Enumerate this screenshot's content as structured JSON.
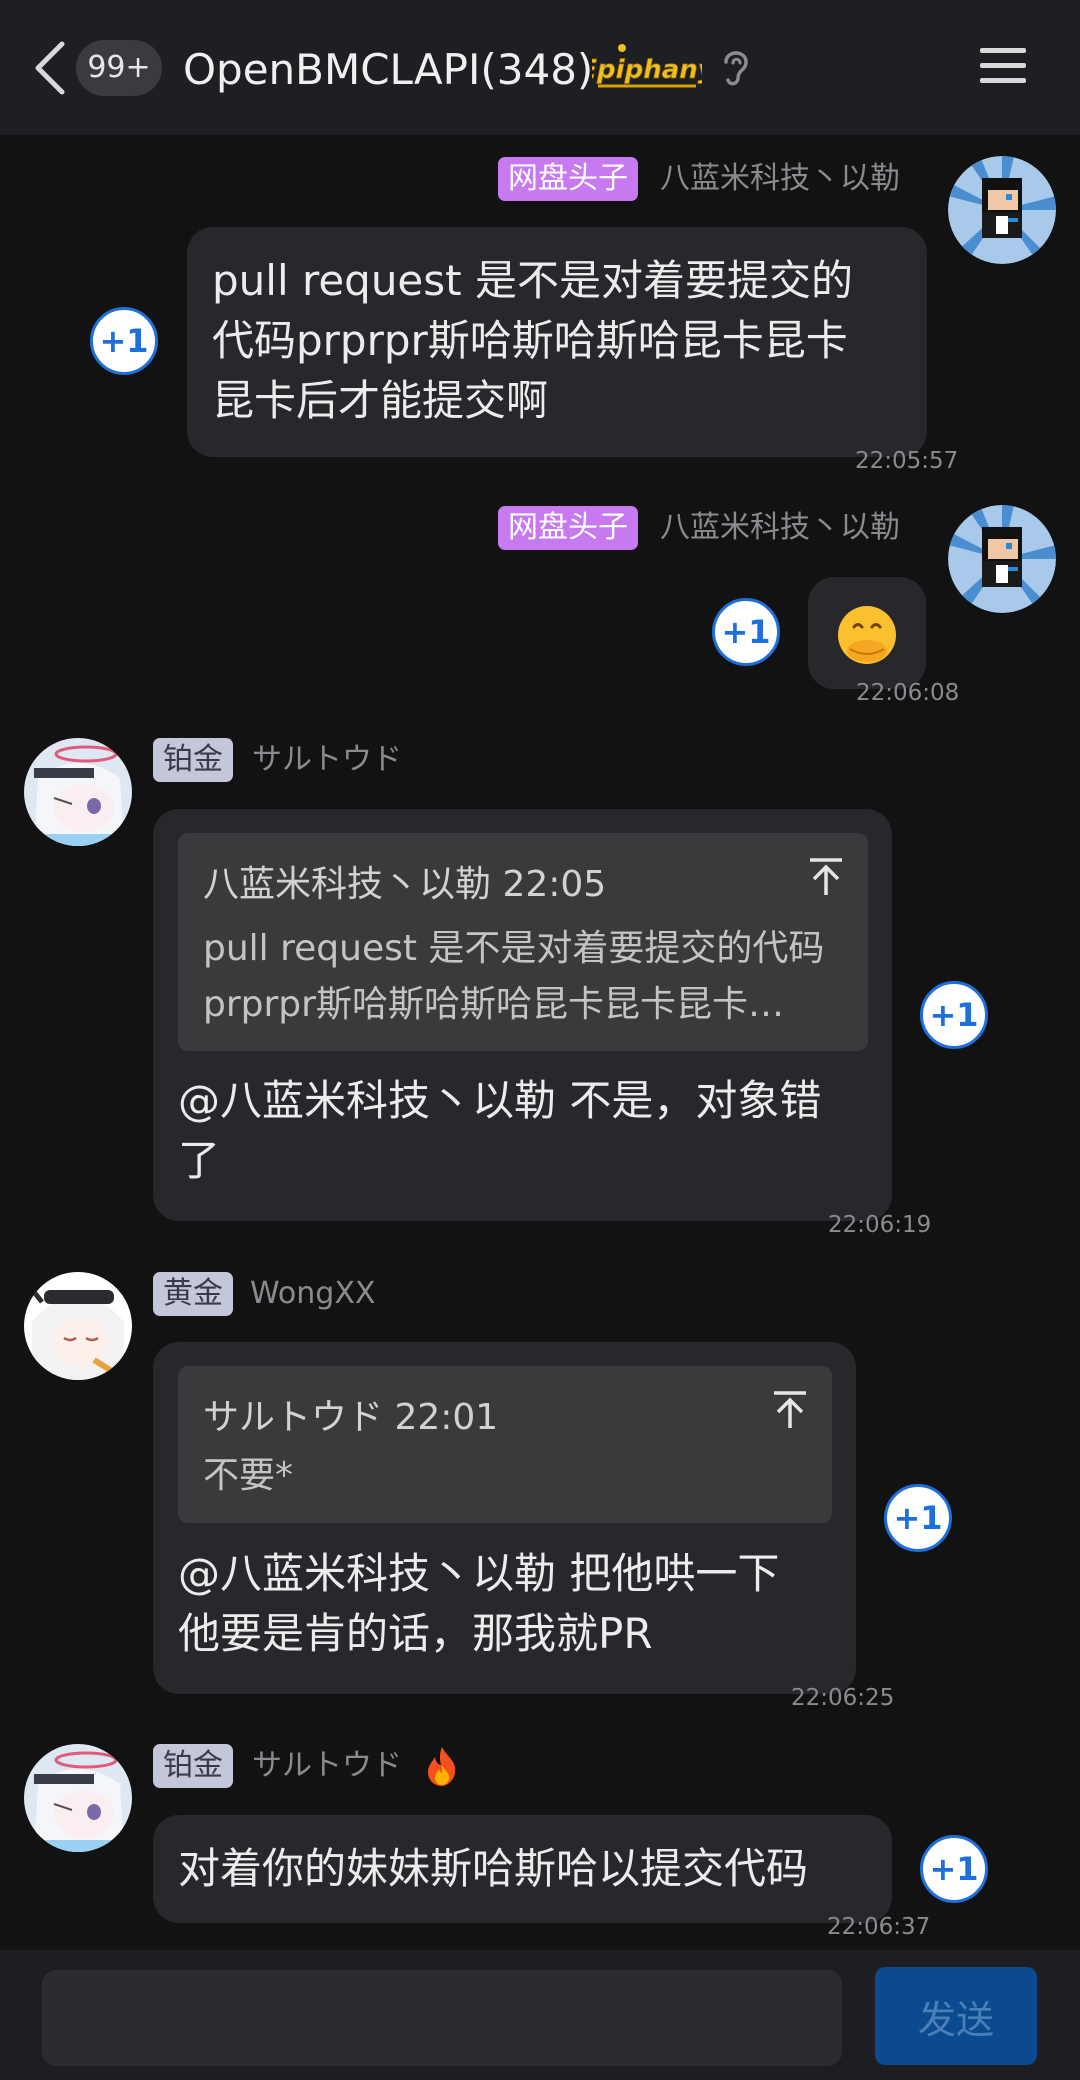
{
  "header": {
    "unread": "99+",
    "title": "OpenBMCLAPI(348)",
    "brand_badge": "Epiphany"
  },
  "messages": [
    {
      "tag": "网盘头子",
      "sender": "八蓝米科技丶以勒",
      "lines": [
        "pull request 是不是对着要提交的",
        "代码prprpr斯哈斯哈斯哈昆卡昆卡",
        "昆卡后才能提交啊"
      ],
      "time": "22:05:57",
      "plus_one": "+1"
    },
    {
      "tag": "网盘头子",
      "sender": "八蓝米科技丶以勒",
      "emoji": "🫢",
      "time": "22:06:08",
      "plus_one": "+1"
    },
    {
      "tag": "铂金",
      "sender": "サルトウド",
      "quote_head": "八蓝米科技丶以勒 22:05",
      "quote_lines": [
        "pull request 是不是对着要提交的代码",
        "prprpr斯哈斯哈斯哈昆卡昆卡昆卡…"
      ],
      "lines": [
        "@八蓝米科技丶以勒 不是，对象错",
        "了"
      ],
      "time": "22:06:19",
      "plus_one": "+1"
    },
    {
      "tag": "黄金",
      "sender": "WongXX",
      "quote_head": "サルトウド 22:01",
      "quote_lines": [
        "不要*"
      ],
      "lines": [
        "@八蓝米科技丶以勒 把他哄一下",
        "他要是肯的话，那我就PR"
      ],
      "time": "22:06:25",
      "plus_one": "+1"
    },
    {
      "tag": "铂金",
      "sender": "サルトウド",
      "sender_emoji": "🔥",
      "lines": [
        "对着你的妹妹斯哈斯哈以提交代码"
      ],
      "time": "22:06:37",
      "plus_one": "+1"
    }
  ],
  "input": {
    "placeholder": "",
    "send_label": "发送"
  },
  "colors": {
    "background": "#121212",
    "bubble": "#27282c",
    "accent_blue": "#1e6fd9",
    "tag_purple": "#c77af0",
    "tag_gray": "#c4c7d9"
  }
}
